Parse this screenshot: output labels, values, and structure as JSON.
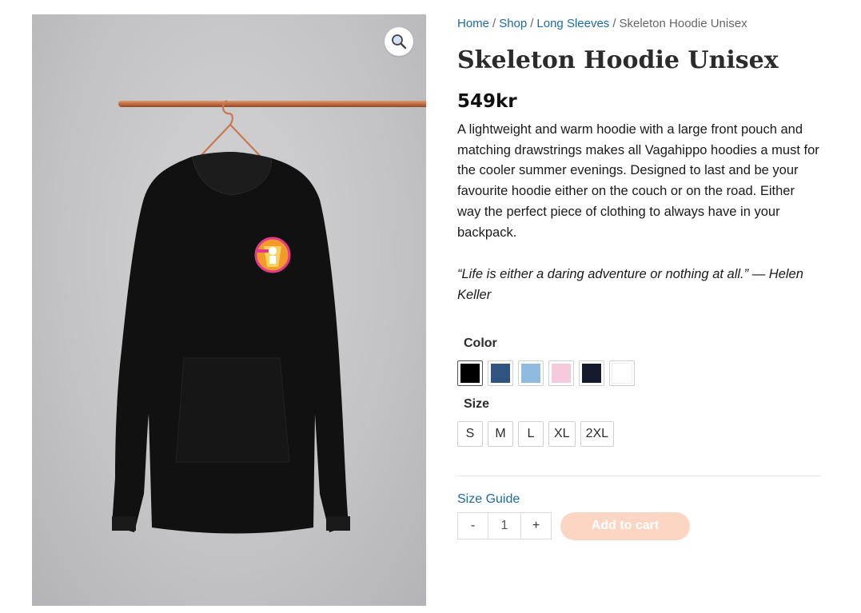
{
  "breadcrumb": {
    "home": "Home",
    "shop": "Shop",
    "category": "Long Sleeves",
    "current": "Skeleton Hoodie Unisex",
    "separator": "/"
  },
  "product": {
    "title": "Skeleton Hoodie Unisex",
    "price": "549kr",
    "description": "A lightweight and warm hoodie with a large front pouch and matching drawstrings makes all Vagahippo hoodies a must for the cooler summer evenings. Designed to last and be your favourite hoodie either on the couch or on the road. Either way the perfect piece of clothing to always have in your backpack.",
    "quote": "“Life is either a daring adventure or nothing at all.” — Helen Keller"
  },
  "gallery": {
    "zoom_icon": "magnifier-icon"
  },
  "attributes": {
    "color_label": "Color",
    "colors": [
      {
        "hex": "#000000",
        "selected": true
      },
      {
        "hex": "#2f5480"
      },
      {
        "hex": "#8fbbe0"
      },
      {
        "hex": "#f7c9dc"
      },
      {
        "hex": "#131b2c"
      },
      {
        "hex": "#ffffff"
      }
    ],
    "size_label": "Size",
    "sizes": [
      "S",
      "M",
      "L",
      "XL",
      "2XL"
    ]
  },
  "purchase": {
    "size_guide": "Size Guide",
    "minus": "-",
    "quantity": "1",
    "plus": "+",
    "add_to_cart": "Add to cart"
  }
}
